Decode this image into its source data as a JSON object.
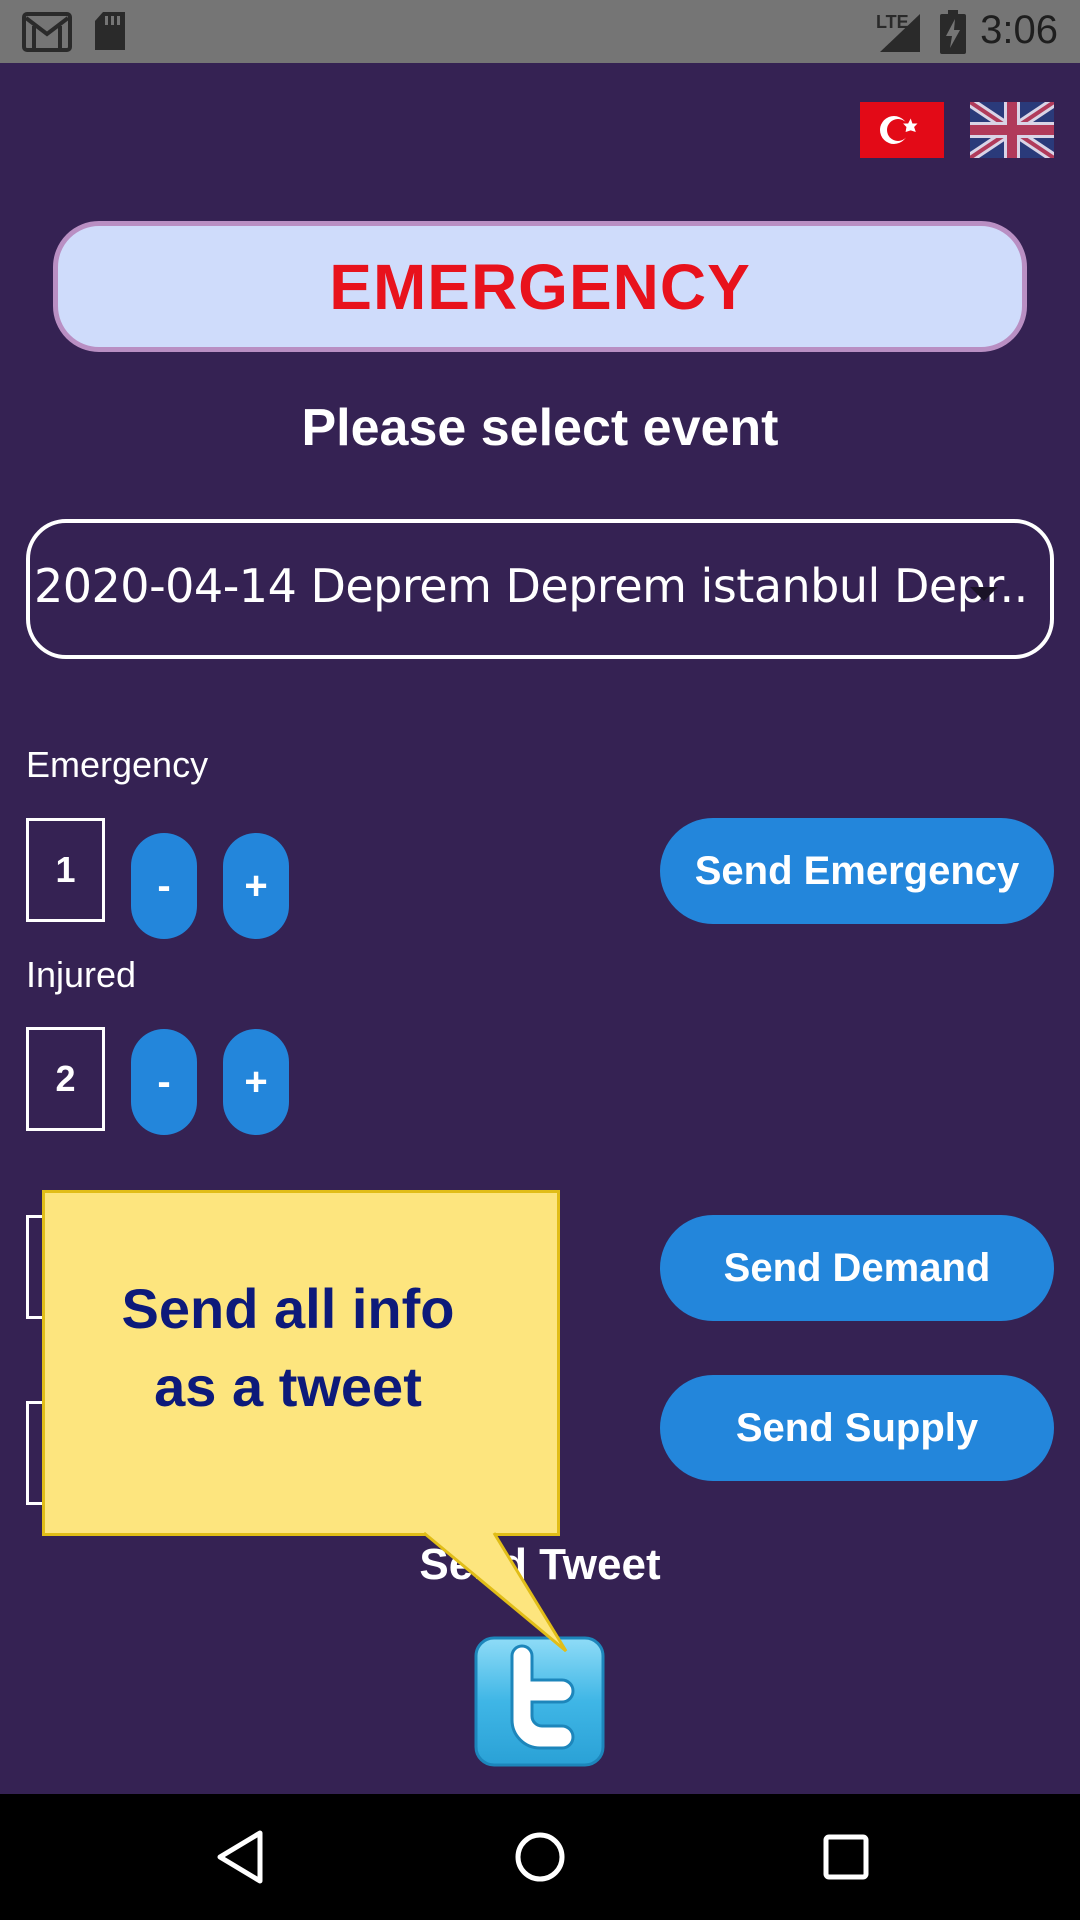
{
  "status_bar": {
    "time": "3:06",
    "network": "LTE",
    "icons": [
      "gmail-icon",
      "sd-card-icon",
      "signal-icon",
      "battery-charging-icon"
    ]
  },
  "flags": {
    "turkish": "turkish-flag-icon",
    "english": "uk-flag-icon"
  },
  "header": {
    "title": "EMERGENCY",
    "subtitle": "Please select event"
  },
  "event_select": {
    "value": "2020-04-14 Deprem Deprem istanbul Depr.."
  },
  "emergency": {
    "label": "Emergency",
    "count": "1",
    "minus": "-",
    "plus": "+",
    "send_label": "Send Emergency"
  },
  "injured": {
    "label": "Injured",
    "count": "2",
    "minus": "-",
    "plus": "+"
  },
  "demand": {
    "send_label": "Send Demand"
  },
  "supply": {
    "send_label": "Send Supply"
  },
  "tweet": {
    "label": "Send Tweet",
    "icon": "twitter-icon"
  },
  "callout": {
    "line1": "Send all info",
    "line2": "as a tweet"
  },
  "colors": {
    "background": "#352253",
    "accent": "#2386db",
    "title_red": "#e8121c",
    "callout_bg": "#fde57e"
  }
}
